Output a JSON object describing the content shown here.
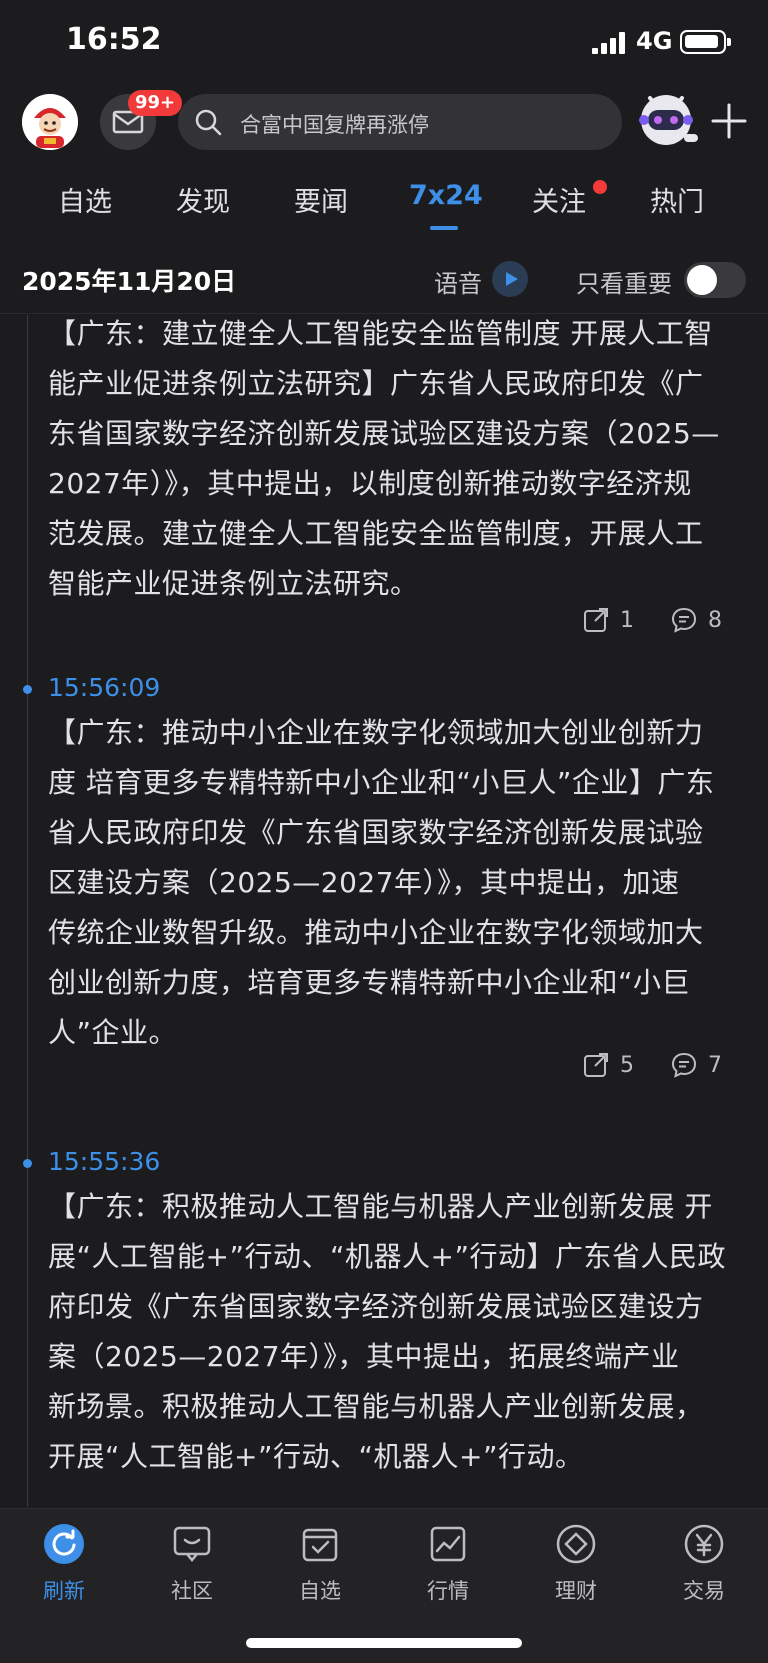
{
  "status_bar": {
    "time": "16:52",
    "network": "4G"
  },
  "header": {
    "mail_badge": "99+",
    "search_placeholder": "合富中国复牌再涨停"
  },
  "tabs": [
    {
      "label": "自选"
    },
    {
      "label": "发现"
    },
    {
      "label": "要闻"
    },
    {
      "label": "7x24",
      "active": true
    },
    {
      "label": "关注",
      "has_dot": true
    },
    {
      "label": "热门"
    }
  ],
  "date_row": {
    "date": "2025年11月20日",
    "voice_label": "语音",
    "important_only_label": "只看重要",
    "important_only_on": false
  },
  "feed": [
    {
      "time": "",
      "lines": [
        "【广东：建立健全人工智能安全监管制度 开展人工智",
        "能产业促进条例立法研究】广东省人民政府印发《广",
        "东省国家数字经济创新发展试验区建设方案（2025—",
        "2027年）》，其中提出，以制度创新推动数字经济规",
        "范发展。建立健全人工智能安全监管制度，开展人工",
        "智能产业促进条例立法研究。"
      ],
      "shares": "1",
      "comments": "8"
    },
    {
      "time": "15:56:09",
      "lines": [
        "【广东：推动中小企业在数字化领域加大创业创新力",
        "度 培育更多专精特新中小企业和“小巨人”企业】广东",
        "省人民政府印发《广东省国家数字经济创新发展试验",
        "区建设方案（2025—2027年）》，其中提出，加速",
        "传统企业数智升级。推动中小企业在数字化领域加大",
        "创业创新力度，培育更多专精特新中小企业和“小巨",
        "人”企业。"
      ],
      "shares": "5",
      "comments": "7"
    },
    {
      "time": "15:55:36",
      "lines": [
        "【广东：积极推动人工智能与机器人产业创新发展 开",
        "展“人工智能+”行动、“机器人+”行动】广东省人民政",
        "府印发《广东省国家数字经济创新发展试验区建设方",
        "案（2025—2027年）》，其中提出，拓展终端产业",
        "新场景。积极推动人工智能与机器人产业创新发展，",
        "开展“人工智能+”行动、“机器人+”行动。"
      ]
    }
  ],
  "bottom_nav": [
    {
      "label": "刷新",
      "icon": "refresh-icon",
      "active": true
    },
    {
      "label": "社区",
      "icon": "chat-bubble-icon"
    },
    {
      "label": "自选",
      "icon": "checkbox-icon"
    },
    {
      "label": "行情",
      "icon": "chart-icon"
    },
    {
      "label": "理财",
      "icon": "diamond-icon"
    },
    {
      "label": "交易",
      "icon": "yen-icon"
    }
  ],
  "colors": {
    "accent": "#3d8fe8",
    "badge": "#f23a3a",
    "background": "#1c1c1e"
  }
}
